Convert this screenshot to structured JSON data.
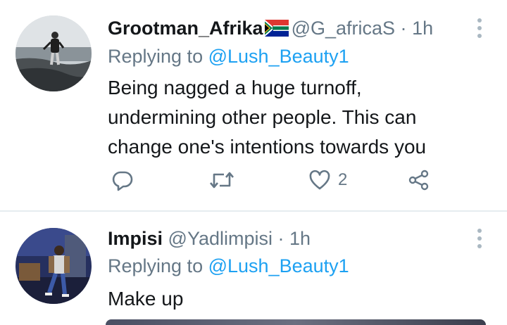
{
  "tweets": [
    {
      "display_name": "Grootman_Afrika",
      "handle": "@G_africaS",
      "separator": "·",
      "time": "1h",
      "replying_prefix": "Replying to",
      "replying_to": "@Lush_Beauty1",
      "text_lines": [
        "Being nagged a huge turnoff,",
        "undermining other people. This can",
        "change one's intentions towards you"
      ],
      "like_count": "2",
      "icons": [
        "reply-icon",
        "retweet-icon",
        "like-icon",
        "share-icon"
      ]
    },
    {
      "display_name": "Impisi",
      "handle": "@Yadlimpisi",
      "separator": "·",
      "time": "1h",
      "replying_prefix": "Replying to",
      "replying_to": "@Lush_Beauty1",
      "text": "Make up"
    }
  ],
  "colors": {
    "link": "#1da1f2",
    "muted": "#657786",
    "text": "#14171a",
    "divider": "#e6ecf0"
  }
}
